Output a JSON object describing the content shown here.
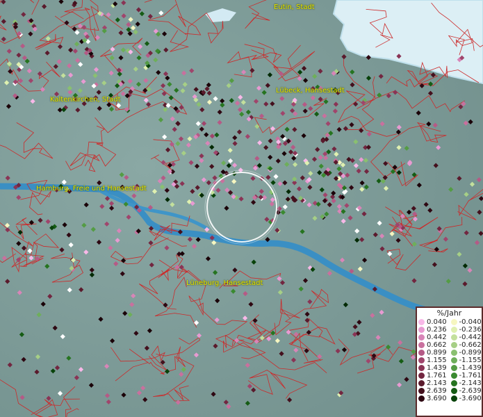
{
  "map": {
    "cities": [
      {
        "name": "Eutin, Stadt"
      },
      {
        "name": "Kaltenkirchen, Stadt"
      },
      {
        "name": "Lübeck, Hansestadt"
      },
      {
        "name": "Hamburg, Freie und Hansestadt"
      },
      {
        "name": "Lüneburg, Hansestadt"
      }
    ],
    "colors": {
      "positive": [
        "#f8b8e8",
        "#e89ad2",
        "#d885b8",
        "#c9709e",
        "#b55a86",
        "#a0456c",
        "#8a3455",
        "#722640",
        "#5a1a2c",
        "#44101d",
        "#2e0812",
        "#1a0208"
      ],
      "negative": [
        "#f6f6c0",
        "#dff0b0",
        "#c3e09c",
        "#a6cf86",
        "#8ac070",
        "#6eaf5a",
        "#549c44",
        "#3a8a30",
        "#267420",
        "#155c14",
        "#08420a",
        "#022a04"
      ]
    }
  },
  "legend": {
    "title": "%/Jahr",
    "positive": [
      "0.040",
      "0.236",
      "0.442",
      "0.662",
      "0.899",
      "1.155",
      "1.439",
      "1.761",
      "2.143",
      "2.639",
      "3.690"
    ],
    "negative": [
      "-0.040",
      "-0.236",
      "-0.442",
      "-0.662",
      "-0.899",
      "-1.155",
      "-1.439",
      "-1.761",
      "-2.143",
      "-2.639",
      "-3.690"
    ]
  }
}
